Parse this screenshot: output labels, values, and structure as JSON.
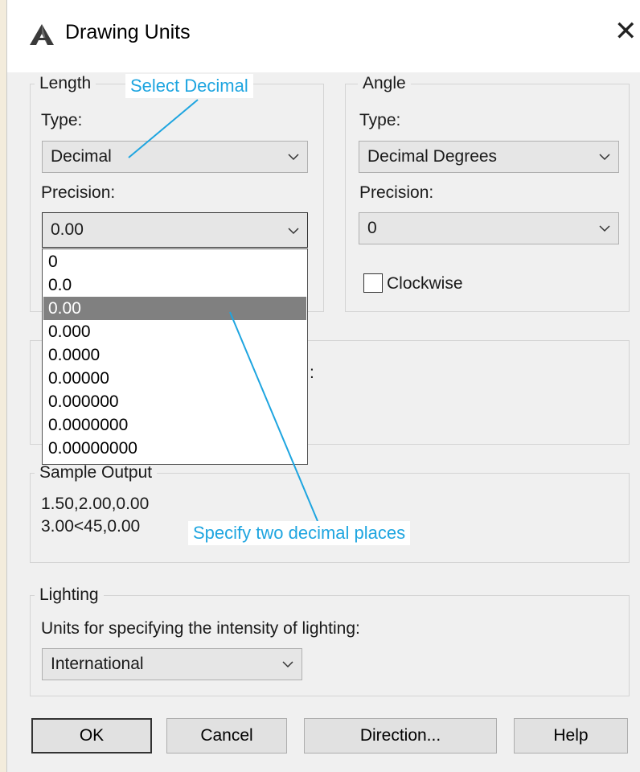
{
  "window": {
    "title": "Drawing Units",
    "close_glyph": "✕"
  },
  "length": {
    "legend": "Length",
    "type_label": "Type:",
    "type_value": "Decimal",
    "precision_label": "Precision:",
    "precision_value": "0.00",
    "precision_options": [
      "0",
      "0.0",
      "0.00",
      "0.000",
      "0.0000",
      "0.00000",
      "0.000000",
      "0.0000000",
      "0.00000000"
    ],
    "selected_option": "0.00"
  },
  "angle": {
    "legend": "Angle",
    "type_label": "Type:",
    "type_value": "Decimal Degrees",
    "precision_label": "Precision:",
    "precision_value": "0",
    "clockwise_label": "Clockwise",
    "clockwise_checked": false
  },
  "insertion_scale": {
    "partial_label": ":"
  },
  "sample_output": {
    "legend": "Sample Output",
    "line1": "1.50,2.00,0.00",
    "line2": "3.00<45,0.00"
  },
  "lighting": {
    "legend": "Lighting",
    "description": "Units for specifying the intensity of lighting:",
    "value": "International"
  },
  "buttons": {
    "ok": "OK",
    "cancel": "Cancel",
    "direction": "Direction...",
    "help": "Help"
  },
  "annotations": {
    "select_decimal": "Select Decimal",
    "two_places": "Specify two decimal places",
    "color": "#1ea5e0"
  },
  "colors": {
    "selection": "#808080",
    "dialog_bg": "#f0f0f0",
    "page_bg": "#f3ecdc"
  }
}
